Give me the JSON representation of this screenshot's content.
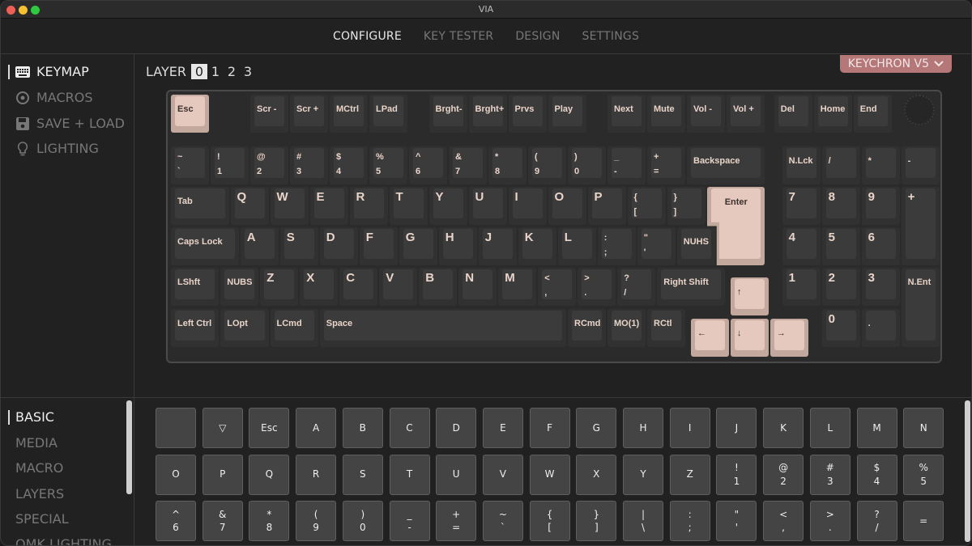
{
  "window": {
    "title": "VIA"
  },
  "nav": {
    "tabs": [
      {
        "label": "CONFIGURE",
        "active": true
      },
      {
        "label": "KEY TESTER"
      },
      {
        "label": "DESIGN"
      },
      {
        "label": "SETTINGS"
      }
    ]
  },
  "sidebar": {
    "items": [
      {
        "label": "KEYMAP",
        "icon": "keyboard-icon",
        "active": true
      },
      {
        "label": "MACROS",
        "icon": "record-icon"
      },
      {
        "label": "SAVE + LOAD",
        "icon": "floppy-icon"
      },
      {
        "label": "LIGHTING",
        "icon": "lightbulb-icon"
      }
    ]
  },
  "layer": {
    "label": "LAYER",
    "options": [
      "0",
      "1",
      "2",
      "3"
    ],
    "selected": "0"
  },
  "device": {
    "name": "KEYCHRON V5"
  },
  "colors": {
    "accent_key": "#e5c9be",
    "device_badge": "#b57777"
  },
  "keymap": [
    {
      "t": "Esc",
      "hl": true
    },
    {
      "t": "Scr -"
    },
    {
      "t": "Scr +"
    },
    {
      "t": "MCtrl"
    },
    {
      "t": "LPad"
    },
    {
      "t": "Brght-"
    },
    {
      "t": "Brght+"
    },
    {
      "t": "Prvs"
    },
    {
      "t": "Play"
    },
    {
      "t": "Next"
    },
    {
      "t": "Mute"
    },
    {
      "t": "Vol -"
    },
    {
      "t": "Vol +"
    },
    {
      "t": "Del"
    },
    {
      "t": "Home"
    },
    {
      "t": "End"
    },
    {
      "t": "~",
      "b": "`"
    },
    {
      "t": "!",
      "b": "1"
    },
    {
      "t": "@",
      "b": "2"
    },
    {
      "t": "#",
      "b": "3"
    },
    {
      "t": "$",
      "b": "4"
    },
    {
      "t": "%",
      "b": "5"
    },
    {
      "t": "^",
      "b": "6"
    },
    {
      "t": "&",
      "b": "7"
    },
    {
      "t": "*",
      "b": "8"
    },
    {
      "t": "(",
      "b": "9"
    },
    {
      "t": ")",
      "b": "0"
    },
    {
      "t": "_",
      "b": "-"
    },
    {
      "t": "+",
      "b": "="
    },
    {
      "t": "Backspace"
    },
    {
      "t": "N.Lck"
    },
    {
      "t": "/"
    },
    {
      "t": "*"
    },
    {
      "t": "-"
    },
    {
      "t": "Tab"
    },
    {
      "t": "Q",
      "big": true
    },
    {
      "t": "W",
      "big": true
    },
    {
      "t": "E",
      "big": true
    },
    {
      "t": "R",
      "big": true
    },
    {
      "t": "T",
      "big": true
    },
    {
      "t": "Y",
      "big": true
    },
    {
      "t": "U",
      "big": true
    },
    {
      "t": "I",
      "big": true
    },
    {
      "t": "O",
      "big": true
    },
    {
      "t": "P",
      "big": true
    },
    {
      "t": "{",
      "b": "["
    },
    {
      "t": "}",
      "b": "]"
    },
    {
      "t": "Enter",
      "hl": true
    },
    {
      "t": "7",
      "big": true
    },
    {
      "t": "8",
      "big": true
    },
    {
      "t": "9",
      "big": true
    },
    {
      "t": "+",
      "big": true
    },
    {
      "t": "Caps Lock"
    },
    {
      "t": "A",
      "big": true
    },
    {
      "t": "S",
      "big": true
    },
    {
      "t": "D",
      "big": true
    },
    {
      "t": "F",
      "big": true
    },
    {
      "t": "G",
      "big": true
    },
    {
      "t": "H",
      "big": true
    },
    {
      "t": "J",
      "big": true
    },
    {
      "t": "K",
      "big": true
    },
    {
      "t": "L",
      "big": true
    },
    {
      "t": ":",
      "b": ";"
    },
    {
      "t": "\"",
      "b": "'"
    },
    {
      "t": "NUHS"
    },
    {
      "t": "4",
      "big": true
    },
    {
      "t": "5",
      "big": true
    },
    {
      "t": "6",
      "big": true
    },
    {
      "t": "LShft"
    },
    {
      "t": "NUBS"
    },
    {
      "t": "Z",
      "big": true
    },
    {
      "t": "X",
      "big": true
    },
    {
      "t": "C",
      "big": true
    },
    {
      "t": "V",
      "big": true
    },
    {
      "t": "B",
      "big": true
    },
    {
      "t": "N",
      "big": true
    },
    {
      "t": "M",
      "big": true
    },
    {
      "t": "<",
      "b": ","
    },
    {
      "t": ">",
      "b": "."
    },
    {
      "t": "?",
      "b": "/"
    },
    {
      "t": "Right Shift"
    },
    {
      "t": "↑",
      "hl": true
    },
    {
      "t": "1",
      "big": true
    },
    {
      "t": "2",
      "big": true
    },
    {
      "t": "3",
      "big": true
    },
    {
      "t": "N.Ent"
    },
    {
      "t": "Left Ctrl"
    },
    {
      "t": "LOpt"
    },
    {
      "t": "LCmd"
    },
    {
      "t": "Space"
    },
    {
      "t": "RCmd"
    },
    {
      "t": "MO(1)"
    },
    {
      "t": "RCtl"
    },
    {
      "t": "←",
      "hl": true
    },
    {
      "t": "↓",
      "hl": true
    },
    {
      "t": "→",
      "hl": true
    },
    {
      "t": "0",
      "big": true
    },
    {
      "t": "."
    }
  ],
  "categories": [
    {
      "label": "BASIC",
      "active": true
    },
    {
      "label": "MEDIA"
    },
    {
      "label": "MACRO"
    },
    {
      "label": "LAYERS"
    },
    {
      "label": "SPECIAL"
    },
    {
      "label": "QMK LIGHTING"
    }
  ],
  "keycodes": [
    {
      "t": ""
    },
    {
      "t": "▽"
    },
    {
      "t": "Esc"
    },
    {
      "t": "A"
    },
    {
      "t": "B"
    },
    {
      "t": "C"
    },
    {
      "t": "D"
    },
    {
      "t": "E"
    },
    {
      "t": "F"
    },
    {
      "t": "G"
    },
    {
      "t": "H"
    },
    {
      "t": "I"
    },
    {
      "t": "J"
    },
    {
      "t": "K"
    },
    {
      "t": "L"
    },
    {
      "t": "M"
    },
    {
      "t": "N"
    },
    {
      "t": "O"
    },
    {
      "t": "P"
    },
    {
      "t": "Q"
    },
    {
      "t": "R"
    },
    {
      "t": "S"
    },
    {
      "t": "T"
    },
    {
      "t": "U"
    },
    {
      "t": "V"
    },
    {
      "t": "W"
    },
    {
      "t": "X"
    },
    {
      "t": "Y"
    },
    {
      "t": "Z"
    },
    {
      "t": "!",
      "b": "1"
    },
    {
      "t": "@",
      "b": "2"
    },
    {
      "t": "#",
      "b": "3"
    },
    {
      "t": "$",
      "b": "4"
    },
    {
      "t": "%",
      "b": "5"
    },
    {
      "t": "^",
      "b": "6"
    },
    {
      "t": "&",
      "b": "7"
    },
    {
      "t": "*",
      "b": "8"
    },
    {
      "t": "(",
      "b": "9"
    },
    {
      "t": ")",
      "b": "0"
    },
    {
      "t": "_",
      "b": "-"
    },
    {
      "t": "+",
      "b": "="
    },
    {
      "t": "~",
      "b": "`"
    },
    {
      "t": "{",
      "b": "["
    },
    {
      "t": "}",
      "b": "]"
    },
    {
      "t": "|",
      "b": "\\"
    },
    {
      "t": ":",
      "b": ";"
    },
    {
      "t": "\"",
      "b": "'"
    },
    {
      "t": "<",
      "b": ","
    },
    {
      "t": ">",
      "b": "."
    },
    {
      "t": "?",
      "b": "/"
    },
    {
      "t": "="
    }
  ]
}
